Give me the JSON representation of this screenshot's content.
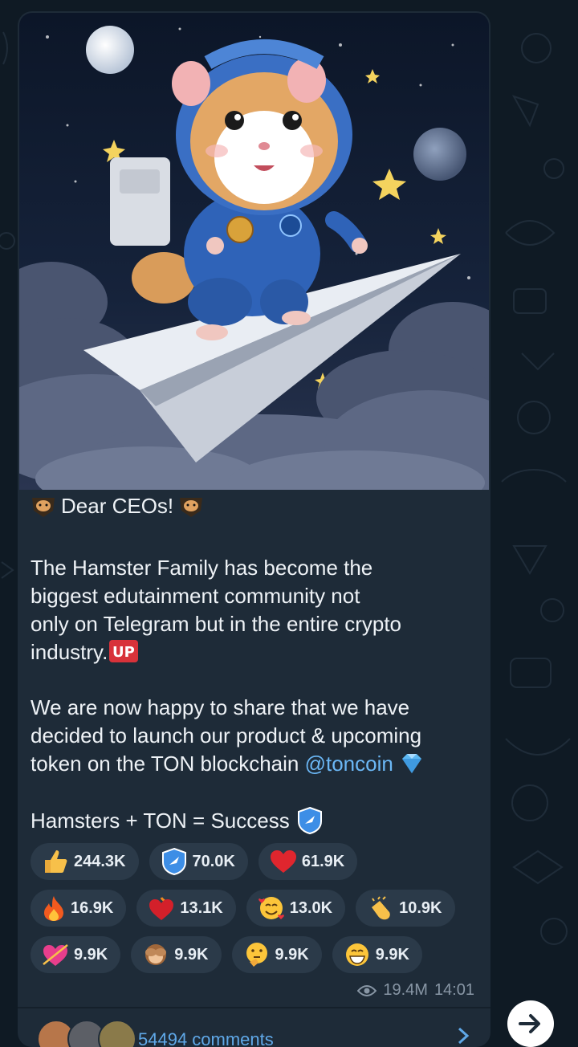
{
  "post": {
    "greeting": "Dear CEOs!",
    "paragraph1": "The Hamster Family has become the\nbiggest edutainment community not\nonly on Telegram but in the entire crypto\nindustry.",
    "paragraph2_before": "We are now happy to share that we have\ndecided to launch our product & upcoming\ntoken on the TON blockchain ",
    "mention": "@toncoin",
    "paragraph3": "Hamsters + TON = Success",
    "views": "19.4M",
    "time": "14:01",
    "comments_label": "54494 comments"
  },
  "reactions": [
    {
      "emoji": "thumbs-up",
      "count": "244.3K"
    },
    {
      "emoji": "ton-shield",
      "count": "70.0K"
    },
    {
      "emoji": "red-heart",
      "count": "61.9K"
    },
    {
      "emoji": "fire",
      "count": "16.9K"
    },
    {
      "emoji": "heart-on-fire",
      "count": "13.1K"
    },
    {
      "emoji": "smiling-hearts",
      "count": "13.0K"
    },
    {
      "emoji": "clapping-hands",
      "count": "10.9K"
    },
    {
      "emoji": "heart-arrow",
      "count": "9.9K"
    },
    {
      "emoji": "see-no-evil-monkey",
      "count": "9.9K"
    },
    {
      "emoji": "thinking-face",
      "count": "9.9K"
    },
    {
      "emoji": "grinning-face",
      "count": "9.9K"
    }
  ],
  "colors": {
    "background": "#0f1a24",
    "bubble": "#1e2b38",
    "pill": "#2b3a49",
    "link": "#6bb7f5",
    "meta": "#8896a5"
  }
}
